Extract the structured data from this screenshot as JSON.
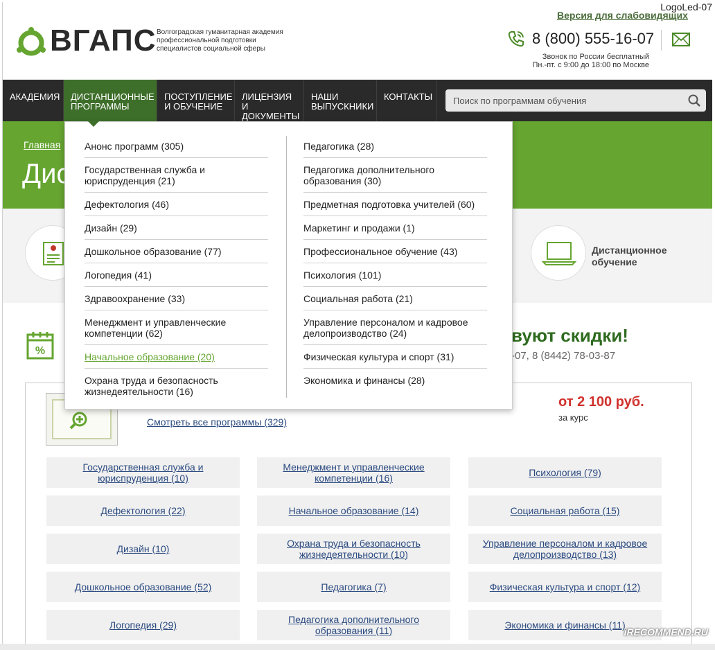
{
  "watermark": "LogoLed-07",
  "header": {
    "logo_text": "ВГАПС",
    "logo_sub": "Волгоградская гуманитарная академия профессиональной подготовки специалистов социальной сферы",
    "low_vision_link": "Версия для слабовидящих",
    "phone": "8 (800) 555-16-07",
    "phone_note1": "Звонок по России бесплатный",
    "phone_note2": "Пн.-пт. с 9:00 до 18:00 по Москве"
  },
  "nav": {
    "items": [
      {
        "label": "Академия"
      },
      {
        "label": "Дистанционные программы"
      },
      {
        "label": "Поступление и обучение"
      },
      {
        "label": "Лицензия и документы"
      },
      {
        "label": "Наши выпускники"
      },
      {
        "label": "Контакты"
      }
    ],
    "search_placeholder": "Поиск по программам обучения"
  },
  "banner": {
    "breadcrumb": "Главная",
    "title": "Дис"
  },
  "features": {
    "right_label": "Дистанционное обучение"
  },
  "discount": {
    "title": "вуют скидки!",
    "phones": "-07, 8 (8442) 78-03-87"
  },
  "card": {
    "see_all": "Смотреть все программы (329)",
    "price": "от 2 100 руб.",
    "price_note": "за курс",
    "grid": [
      "Государственная служба и юриспруденция (10)",
      "Менеджмент и управленческие компетенции (16)",
      "Психология (79)",
      "Дефектология (22)",
      "Начальное образование (14)",
      "Социальная работа (15)",
      "Дизайн (10)",
      "Охрана труда и безопасность жизнедеятельности (10)",
      "Управление персоналом и кадровое делопроизводство (13)",
      "Дошкольное образование (52)",
      "Педагогика (7)",
      "Физическая культура и спорт (12)",
      "Логопедия (29)",
      "Педагогика дополнительного образования (11)",
      "Экономика и финансы (11)"
    ]
  },
  "dropdown": {
    "left": [
      "Анонс программ (305)",
      "Государственная служба и юриспруденция (21)",
      "Дефектология (46)",
      "Дизайн (29)",
      "Дошкольное образование (77)",
      "Логопедия (41)",
      "Здравоохранение (33)",
      "Менеджмент и управленческие компетенции (62)",
      "Начальное образование (20)",
      "Охрана труда и безопасность жизнедеятельности (16)"
    ],
    "right": [
      "Педагогика (28)",
      "Педагогика дополнительного образования (30)",
      "Предметная подготовка учителей (60)",
      "Маркетинг и продажи (1)",
      "Профессиональное обучение (43)",
      "Психология (101)",
      "Социальная работа (21)",
      "Управление персоналом и кадровое делопроизводство (24)",
      "Физическая культура и спорт (31)",
      "Экономика и финансы (28)"
    ]
  },
  "recommend_badge": "iRECOMMEND.RU",
  "colors": {
    "brand_green": "#65a530",
    "nav_active": "#3d6e2a",
    "nav_bg": "#2a2a2a",
    "link_blue": "#2b4a80",
    "price_red": "#d0312d"
  }
}
